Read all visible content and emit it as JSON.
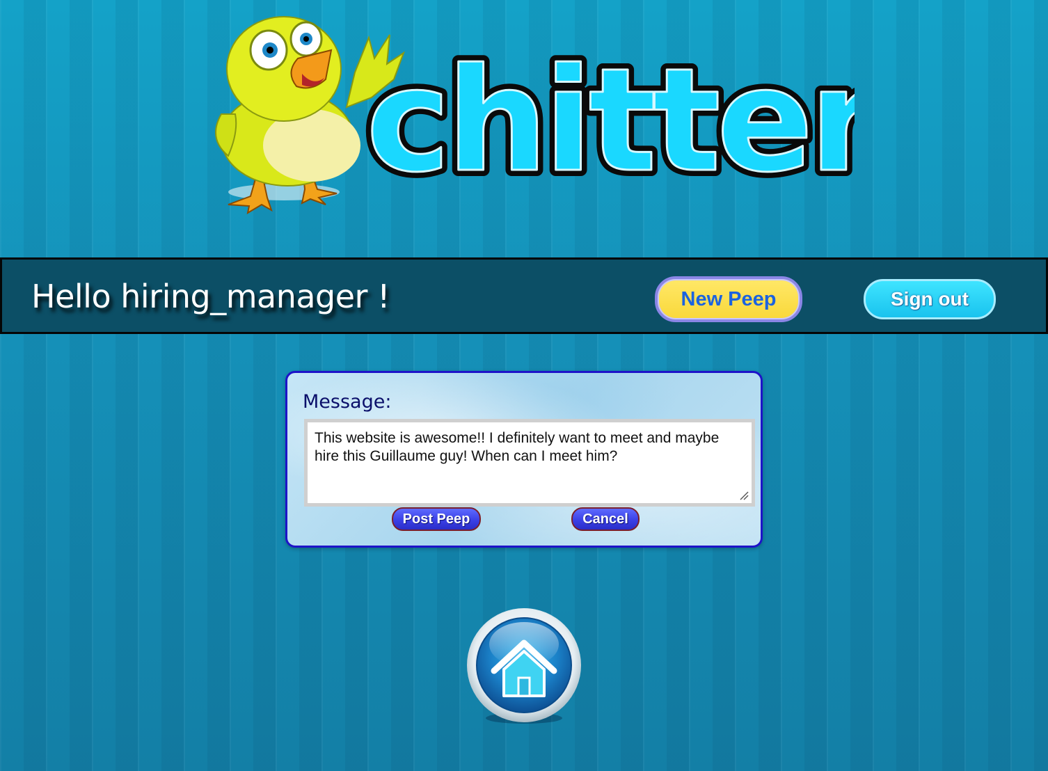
{
  "app": {
    "logo_text": "chitter"
  },
  "header": {
    "greeting": "Hello hiring_manager !",
    "new_peep_label": "New Peep",
    "sign_out_label": "Sign out"
  },
  "compose": {
    "label": "Message:",
    "message_value": "This website is awesome!! I definitely want to meet and maybe hire this Guillaume guy! When can I meet him?",
    "post_label": "Post Peep",
    "cancel_label": "Cancel"
  },
  "icons": {
    "logo_bird": "bird-mascot-icon",
    "home": "home-icon",
    "resize": "resize-grip-icon"
  },
  "colors": {
    "background": "#1690b8",
    "header_bar": "#0c4f66",
    "new_peep_bg": "#f9d83a",
    "new_peep_text": "#1b63e0",
    "sign_out_bg": "#19c3ee",
    "panel_border": "#1d13c9",
    "panel_button": "#3b40e6",
    "logo_letters": "#1ad8ff"
  }
}
